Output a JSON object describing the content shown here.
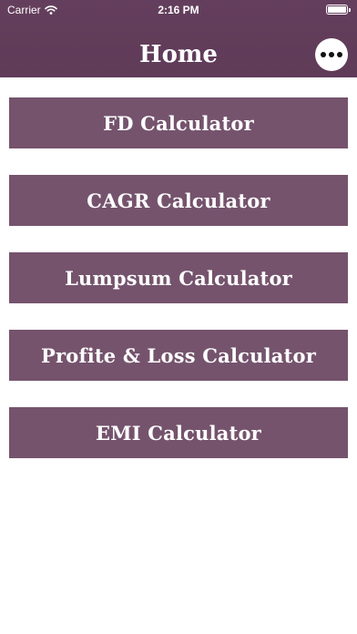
{
  "status_bar": {
    "carrier": "Carrier",
    "time": "2:16 PM"
  },
  "header": {
    "title": "Home",
    "more_icon": "ellipsis-icon"
  },
  "menu": {
    "items": [
      {
        "label": "FD Calculator"
      },
      {
        "label": "CAGR Calculator"
      },
      {
        "label": "Lumpsum Calculator"
      },
      {
        "label": "Profite & Loss Calculator"
      },
      {
        "label": "EMI Calculator"
      }
    ]
  },
  "colors": {
    "header_bg": "#643f5d",
    "button_bg": "#75536d",
    "text": "#ffffff"
  }
}
